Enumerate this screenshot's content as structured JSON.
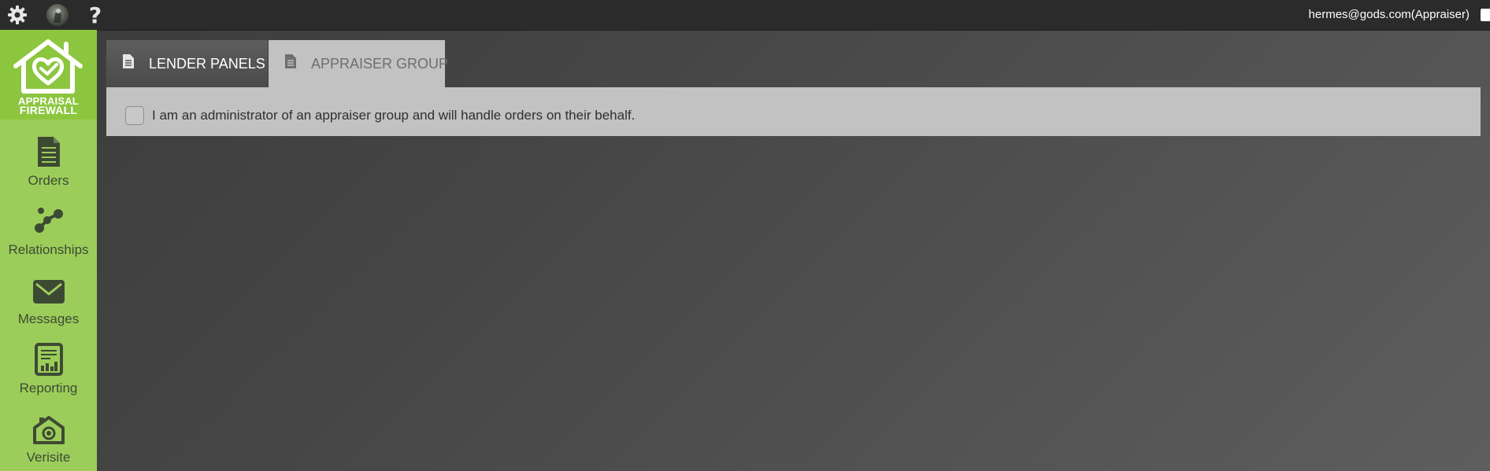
{
  "topbar": {
    "user_email": "hermes@gods.com(Appraiser)",
    "help_glyph": "?",
    "icons": [
      "gear-icon",
      "avatar",
      "help-icon",
      "logout-icon"
    ]
  },
  "logo": {
    "line1": "APPRAISAL",
    "line2": "FIREWALL"
  },
  "sidebar": {
    "items": [
      {
        "label": "Orders",
        "icon": "document-icon"
      },
      {
        "label": "Relationships",
        "icon": "relationships-icon"
      },
      {
        "label": "Messages",
        "icon": "envelope-icon"
      },
      {
        "label": "Reporting",
        "icon": "report-icon"
      },
      {
        "label": "Verisite",
        "icon": "camera-home-icon"
      }
    ]
  },
  "tabs": [
    {
      "label": "LENDER PANELS",
      "active": false
    },
    {
      "label": "APPRAISER GROUP",
      "active": true
    }
  ],
  "panel": {
    "checkbox_label": "I am an administrator of an appraiser group and will handle orders on their behalf.",
    "checked": false
  },
  "colors": {
    "sidebar": "#9ccd5b",
    "logo_bg": "#8cc63f",
    "topbar": "#2b2b2b",
    "panel": "#c2c2c2"
  }
}
